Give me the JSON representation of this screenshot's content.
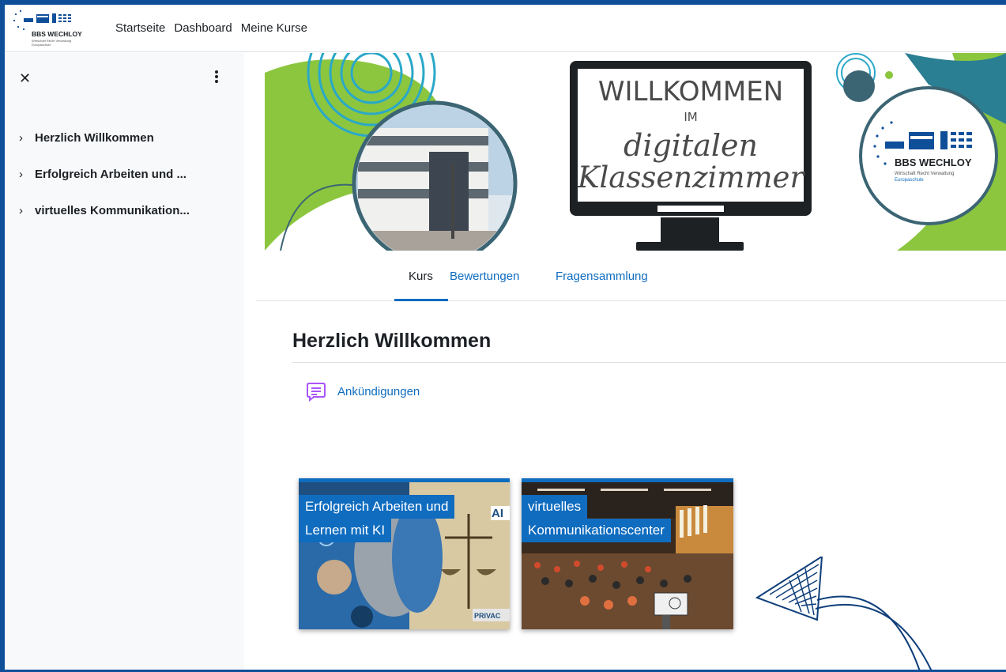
{
  "colors": {
    "frame": "#0f4f9a",
    "accent": "#0f6cbf",
    "green": "#8cc63f",
    "teal": "#2a7f93",
    "drawer_bg": "#f8f9fa"
  },
  "logo": {
    "name": "BBS WECHLOY",
    "tagline": "Wirtschaft Recht Verwaltung",
    "subtitle": "Europaschule"
  },
  "navbar": {
    "links": [
      "Startseite",
      "Dashboard",
      "Meine Kurse"
    ]
  },
  "drawer": {
    "close_icon": "close-icon",
    "menu_icon": "kebab-menu-icon",
    "items": [
      {
        "label": "Herzlich Willkommen",
        "icon": "chevron-right-icon"
      },
      {
        "label": "Erfolgreich Arbeiten und ...",
        "icon": "chevron-right-icon"
      },
      {
        "label": "virtuelles Kommunikation...",
        "icon": "chevron-right-icon"
      }
    ]
  },
  "banner": {
    "line1": "WILLKOMMEN",
    "line2": "IM",
    "line3": "digitalen",
    "line4": "Klassenzimmer",
    "badge_name": "BBS WECHLOY",
    "badge_tagline": "Wirtschaft Recht Verwaltung",
    "badge_subtitle": "Europaschule"
  },
  "tabs": [
    {
      "label": "Kurs",
      "active": true
    },
    {
      "label": "Bewertungen",
      "active": false
    },
    {
      "label": "Fragensammlung",
      "active": false
    }
  ],
  "section": {
    "title": "Herzlich Willkommen",
    "activity": {
      "label": "Ankündigungen",
      "icon": "forum-icon"
    }
  },
  "cards": [
    {
      "line1": "Erfolgreich Arbeiten und",
      "line2": "Lernen mit KI",
      "image": "ai-collage",
      "overlay_text_ai": "AI",
      "overlay_text_privacy": "PRIVAC"
    },
    {
      "line1": "virtuelles",
      "line2": "Kommunikationscenter",
      "image": "virtual-auditorium"
    }
  ]
}
